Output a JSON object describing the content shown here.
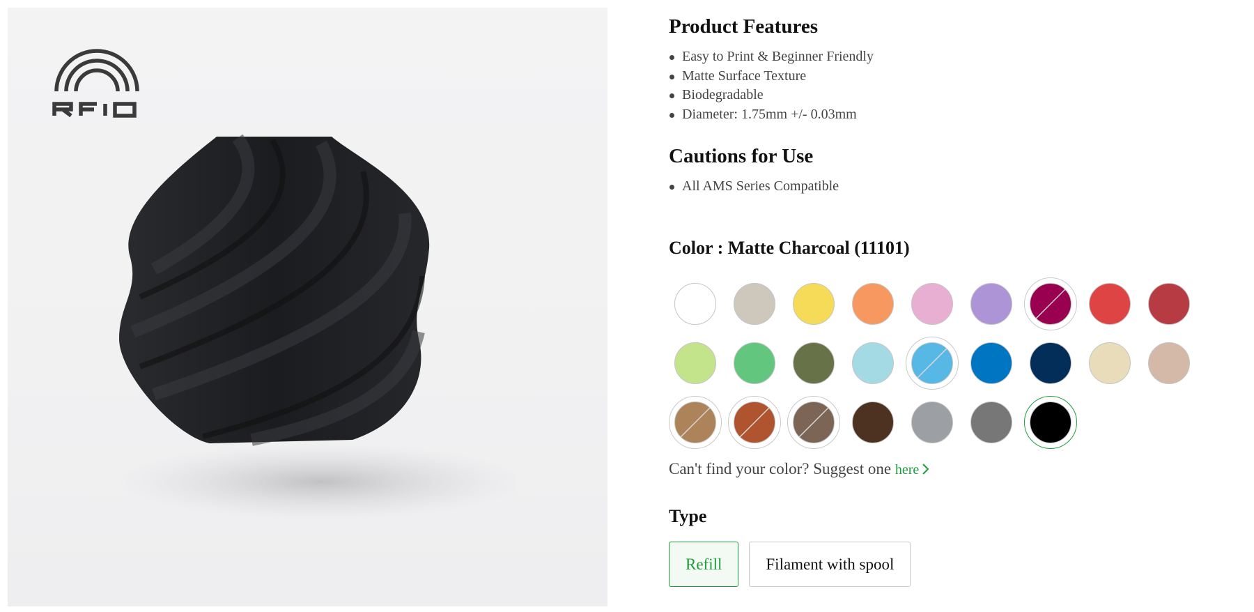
{
  "features": {
    "title": "Product Features",
    "items": [
      "Easy to Print & Beginner Friendly",
      "Matte Surface Texture",
      "Biodegradable",
      "Diameter: 1.75mm +/- 0.03mm"
    ]
  },
  "cautions": {
    "title": "Cautions for Use",
    "items": [
      "All AMS Series Compatible"
    ]
  },
  "color": {
    "title": "Color : Matte Charcoal (11101)",
    "swatches": [
      {
        "hex": "#ffffff",
        "state": "normal"
      },
      {
        "hex": "#cdc7bc",
        "state": "normal"
      },
      {
        "hex": "#f5db58",
        "state": "normal"
      },
      {
        "hex": "#f79860",
        "state": "normal"
      },
      {
        "hex": "#e9afd2",
        "state": "normal"
      },
      {
        "hex": "#ad94d6",
        "state": "normal"
      },
      {
        "hex": "#990050",
        "state": "discontinued"
      },
      {
        "hex": "#df4444",
        "state": "normal"
      },
      {
        "hex": "#b73b42",
        "state": "normal"
      },
      {
        "hex": "#c4e48c",
        "state": "normal"
      },
      {
        "hex": "#63c67f",
        "state": "normal"
      },
      {
        "hex": "#677249",
        "state": "normal"
      },
      {
        "hex": "#a4dae3",
        "state": "normal"
      },
      {
        "hex": "#57b8e6",
        "state": "discontinued"
      },
      {
        "hex": "#0075c2",
        "state": "normal"
      },
      {
        "hex": "#042e5a",
        "state": "normal"
      },
      {
        "hex": "#e9dcba",
        "state": "normal"
      },
      {
        "hex": "#d4b9a8",
        "state": "normal"
      },
      {
        "hex": "#ad8459",
        "state": "discontinued"
      },
      {
        "hex": "#b05430",
        "state": "discontinued"
      },
      {
        "hex": "#7d6556",
        "state": "discontinued"
      },
      {
        "hex": "#4e3221",
        "state": "normal"
      },
      {
        "hex": "#9ca0a4",
        "state": "normal"
      },
      {
        "hex": "#777777",
        "state": "normal"
      },
      {
        "hex": "#000000",
        "state": "selected"
      }
    ]
  },
  "suggest": {
    "text": "Can't find your color? Suggest one ",
    "link": "here"
  },
  "type": {
    "title": "Type",
    "options": [
      {
        "label": "Refill",
        "active": true
      },
      {
        "label": "Filament with spool",
        "active": false
      }
    ]
  },
  "accent_color": "#1e9b3c",
  "icons": {
    "logo": "rfid-logo-icon",
    "chevron": "chevron-right-icon"
  }
}
